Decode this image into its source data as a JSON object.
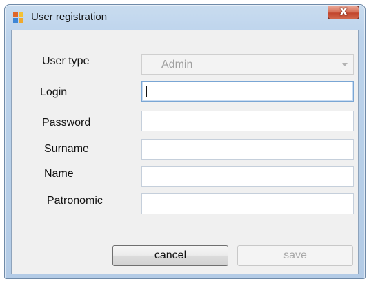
{
  "window": {
    "title": "User registration",
    "close_glyph": "X",
    "icon": "app-window-icon"
  },
  "form": {
    "user_type": {
      "label": "User type",
      "value": "Admin",
      "enabled": false
    },
    "login": {
      "label": "Login",
      "value": ""
    },
    "password": {
      "label": "Password",
      "value": ""
    },
    "surname": {
      "label": "Surname",
      "value": ""
    },
    "name": {
      "label": "Name",
      "value": ""
    },
    "patronomic": {
      "label": "Patronomic",
      "value": ""
    }
  },
  "buttons": {
    "cancel_label": "cancel",
    "save_label": "save"
  }
}
